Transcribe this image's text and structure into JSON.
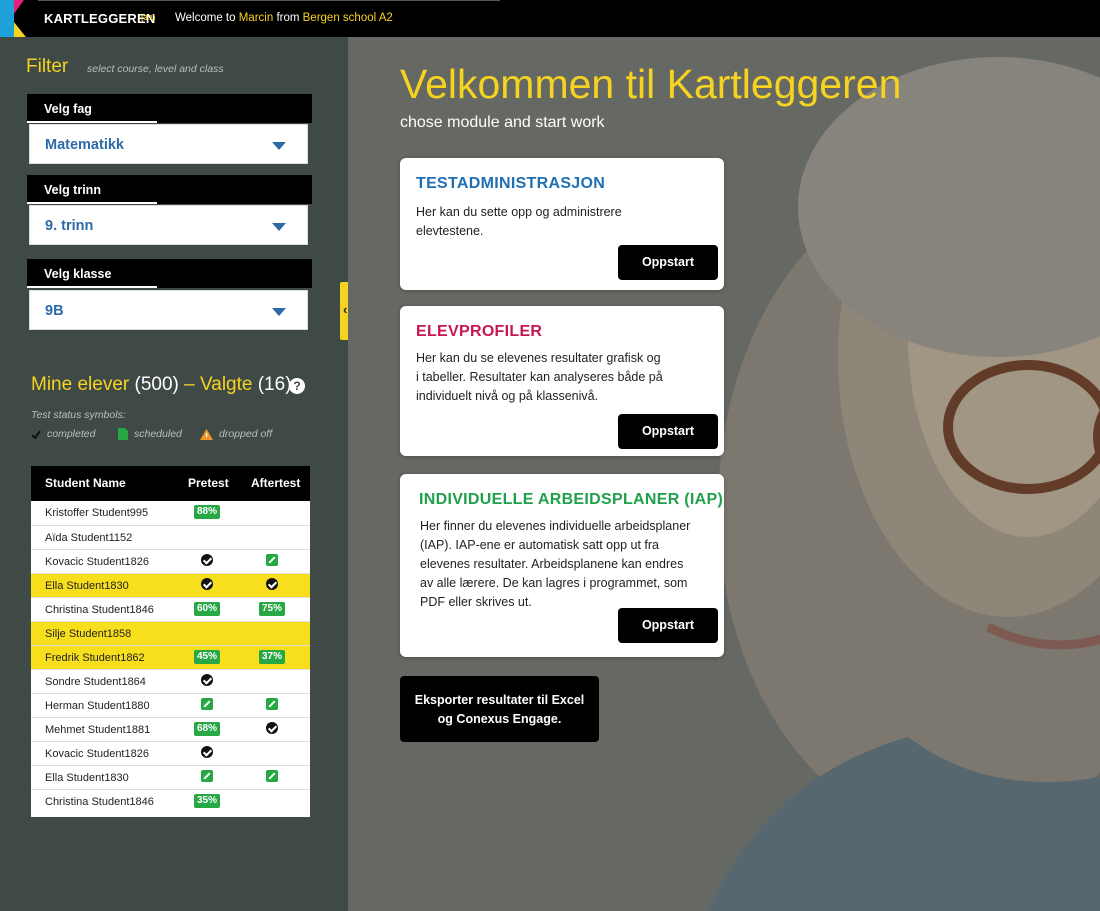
{
  "topbar": {
    "app_name": "KARTLEGGEREN",
    "version": "(3.1)",
    "welcome_prefix": "Welcome to",
    "user": "Marcin",
    "from": "from",
    "school": "Bergen school A2"
  },
  "filter": {
    "title": "Filter",
    "subtitle": "select course, level and class",
    "selects": [
      {
        "label": "Velg fag",
        "value": "Matematikk"
      },
      {
        "label": "Velg trinn",
        "value": "9. trinn"
      },
      {
        "label": "Velg klasse",
        "value": "9B"
      }
    ]
  },
  "students": {
    "mine_label": "Mine elever",
    "mine_count": "(500)",
    "selected_label": "– Valgte",
    "selected_count": "(16)",
    "status_caption": "Test status symbols:",
    "legend": {
      "completed": "completed",
      "scheduled": "scheduled",
      "dropped": "dropped off"
    },
    "headers": {
      "name": "Student Name",
      "pretest": "Pretest",
      "aftertest": "Aftertest"
    },
    "rows": [
      {
        "name": "Kristoffer Student995",
        "pre": "88%",
        "post": ""
      },
      {
        "name": "Aïda Student1152",
        "pre": "",
        "post": ""
      },
      {
        "name": "Kovacic Student1826",
        "pre": "done",
        "post": "edit"
      },
      {
        "name": "Ella Student1830",
        "pre": "done",
        "post": "done",
        "highlight": true
      },
      {
        "name": "Christina Student1846",
        "pre": "60%",
        "post": "75%"
      },
      {
        "name": "Silje Student1858",
        "pre": "",
        "post": "",
        "highlight": true
      },
      {
        "name": "Fredrik Student1862",
        "pre": "45%",
        "post": "37%",
        "highlight": true
      },
      {
        "name": "Sondre Student1864",
        "pre": "done",
        "post": ""
      },
      {
        "name": "Herman Student1880",
        "pre": "edit",
        "post": "edit"
      },
      {
        "name": "Mehmet Student1881",
        "pre": "68%",
        "post": "done"
      },
      {
        "name": "Kovacic Student1826",
        "pre": "done",
        "post": ""
      },
      {
        "name": "Ella Student1830",
        "pre": "edit",
        "post": "edit"
      },
      {
        "name": "Christina Student1846",
        "pre": "35%",
        "post": ""
      }
    ]
  },
  "main": {
    "title": "Velkommen til Kartleggeren",
    "subtitle": "chose module and start work",
    "cards": [
      {
        "title": "TESTADMINISTRASJON",
        "color": "#1f6fb2",
        "text_lines": [
          "Her kan du sette opp og administrere",
          "elevtestene."
        ],
        "button": "Oppstart"
      },
      {
        "title": "ELEVPROFILER",
        "color": "#c8174f",
        "text_lines": [
          "Her kan du se elevenes resultater grafisk og",
          "i tabeller. Resultater kan analyseres både på",
          "individuelt nivå og på klassenivå."
        ],
        "button": "Oppstart"
      },
      {
        "title": "INDIVIDUELLE ARBEIDSPLANER (IAP)",
        "color": "#1fa14b",
        "text_lines": [
          "Her finner du elevenes individuelle arbeidsplaner",
          "(IAP). IAP-ene er automatisk satt opp ut fra",
          "elevenes resultater. Arbeidsplanene kan endres",
          "av alle lærere. De kan lagres i programmet, som",
          "PDF eller skrives ut."
        ],
        "button": "Oppstart"
      }
    ],
    "export_lines": [
      "Eksporter resultater til Excel",
      "og Conexus Engage."
    ]
  },
  "colors": {
    "accent": "#f6d321",
    "sidebar": "#3f4a47",
    "select_text": "#2c6aa8",
    "percent_badge": "#28a745"
  }
}
